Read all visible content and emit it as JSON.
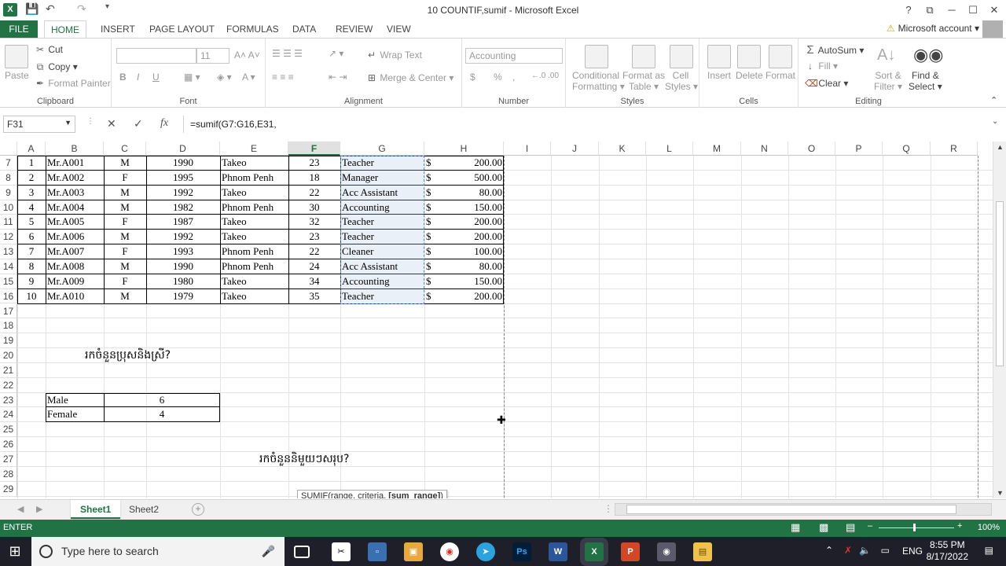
{
  "window": {
    "app_icon": "X",
    "title": "10 COUNTIF,sumif - Microsoft Excel",
    "help": "?",
    "ribbon_display": "⧉",
    "minimize": "─",
    "maximize": "☐",
    "close": "✕"
  },
  "ribbon_tabs": [
    "FILE",
    "HOME",
    "INSERT",
    "PAGE LAYOUT",
    "FORMULAS",
    "DATA",
    "REVIEW",
    "VIEW"
  ],
  "account": {
    "warning": "⚠",
    "label": "Microsoft account"
  },
  "ribbon": {
    "clipboard": {
      "label": "Clipboard",
      "paste": "Paste",
      "cut": "Cut",
      "copy": "Copy",
      "format_painter": "Format Painter"
    },
    "font": {
      "label": "Font",
      "font_name": "",
      "font_size": "11",
      "bold": "B",
      "italic": "I",
      "underline": "U"
    },
    "alignment": {
      "label": "Alignment",
      "wrap_text": "Wrap Text",
      "merge_center": "Merge & Center"
    },
    "number": {
      "label": "Number",
      "format": "Accounting",
      "currency": "$",
      "percent": "%",
      "comma": ","
    },
    "styles": {
      "label": "Styles",
      "conditional": "Conditional",
      "conditional2": "Formatting",
      "format_as": "Format as",
      "format_as2": "Table",
      "cell": "Cell",
      "cell2": "Styles"
    },
    "cells": {
      "label": "Cells",
      "insert": "Insert",
      "delete": "Delete",
      "format": "Format"
    },
    "editing": {
      "label": "Editing",
      "autosum": "AutoSum",
      "fill": "Fill",
      "clear": "Clear",
      "sort": "Sort &",
      "sort2": "Filter",
      "find": "Find &",
      "find2": "Select"
    }
  },
  "formula_bar": {
    "name_box": "F31",
    "cancel": "✕",
    "enter": "✓",
    "fx": "fx",
    "formula": "=sumif(G7:G16,E31,"
  },
  "columns": [
    "A",
    "B",
    "C",
    "D",
    "E",
    "F",
    "G",
    "H",
    "I",
    "J",
    "K",
    "L",
    "M",
    "N",
    "O",
    "P",
    "Q",
    "R"
  ],
  "row_numbers": [
    "7",
    "8",
    "9",
    "10",
    "11",
    "12",
    "13",
    "14",
    "15",
    "16",
    "17",
    "18",
    "19",
    "20",
    "21",
    "22",
    "23",
    "24",
    "25",
    "26",
    "27",
    "28",
    "29"
  ],
  "table": [
    {
      "a": "1",
      "b": "Mr.A001",
      "c": "M",
      "d": "1990",
      "e": "Takeo",
      "f": "23",
      "g": "Teacher",
      "cur": "$",
      "h": "200.00"
    },
    {
      "a": "2",
      "b": "Mr.A002",
      "c": "F",
      "d": "1995",
      "e": "Phnom Penh",
      "f": "18",
      "g": "Manager",
      "cur": "$",
      "h": "500.00"
    },
    {
      "a": "3",
      "b": "Mr.A003",
      "c": "M",
      "d": "1992",
      "e": "Takeo",
      "f": "22",
      "g": "Acc Assistant",
      "cur": "$",
      "h": "80.00"
    },
    {
      "a": "4",
      "b": "Mr.A004",
      "c": "M",
      "d": "1982",
      "e": "Phnom Penh",
      "f": "30",
      "g": "Accounting",
      "cur": "$",
      "h": "150.00"
    },
    {
      "a": "5",
      "b": "Mr.A005",
      "c": "F",
      "d": "1987",
      "e": "Takeo",
      "f": "32",
      "g": "Teacher",
      "cur": "$",
      "h": "200.00"
    },
    {
      "a": "6",
      "b": "Mr.A006",
      "c": "M",
      "d": "1992",
      "e": "Takeo",
      "f": "23",
      "g": "Teacher",
      "cur": "$",
      "h": "200.00"
    },
    {
      "a": "7",
      "b": "Mr.A007",
      "c": "F",
      "d": "1993",
      "e": "Phnom Penh",
      "f": "22",
      "g": "Cleaner",
      "cur": "$",
      "h": "100.00"
    },
    {
      "a": "8",
      "b": "Mr.A008",
      "c": "M",
      "d": "1990",
      "e": "Phnom Penh",
      "f": "24",
      "g": "Acc Assistant",
      "cur": "$",
      "h": "80.00"
    },
    {
      "a": "9",
      "b": "Mr.A009",
      "c": "F",
      "d": "1980",
      "e": "Takeo",
      "f": "34",
      "g": "Accounting",
      "cur": "$",
      "h": "150.00"
    },
    {
      "a": "10",
      "b": "Mr.A010",
      "c": "M",
      "d": "1979",
      "e": "Takeo",
      "f": "35",
      "g": "Teacher",
      "cur": "$",
      "h": "200.00"
    }
  ],
  "question1": "រកចំនួនប្រុសនិងស្រី?",
  "summary": [
    {
      "label": "Male",
      "value": "6"
    },
    {
      "label": "Female",
      "value": "4"
    }
  ],
  "question2": "រកចំនួននិមួយៗសរុប?",
  "tooltip": {
    "prefix": "SUMIF(range, criteria, ",
    "bold": "[sum_range]",
    "suffix": ")"
  },
  "sheets": [
    "Sheet1",
    "Sheet2"
  ],
  "add_sheet": "+",
  "status": {
    "mode": "ENTER",
    "zoom": "100%"
  },
  "taskbar": {
    "search_placeholder": "Type here to search",
    "language": "ENG",
    "time": "8:55 PM",
    "date": "8/17/2022"
  },
  "colors": {
    "excel_green": "#217346",
    "selection": "#5b8fd0"
  }
}
